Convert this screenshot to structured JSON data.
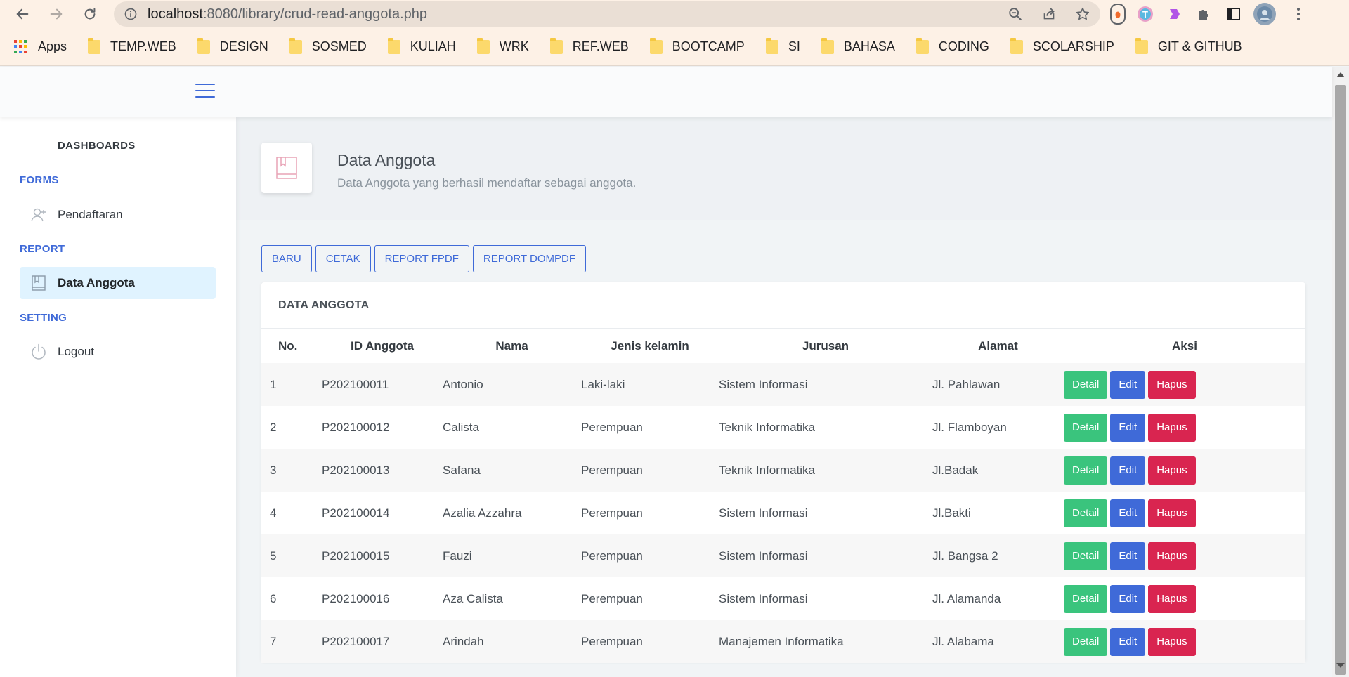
{
  "browser": {
    "url_host": "localhost",
    "url_rest": ":8080/library/crud-read-anggota.php",
    "apps_label": "Apps",
    "bookmarks": [
      "TEMP.WEB",
      "DESIGN",
      "SOSMED",
      "KULIAH",
      "WRK",
      "REF.WEB",
      "BOOTCAMP",
      "SI",
      "BAHASA",
      "CODING",
      "SCOLARSHIP",
      "GIT & GITHUB"
    ]
  },
  "sidebar": {
    "dashboards": "DASHBOARDS",
    "forms_heading": "FORMS",
    "pendaftaran": "Pendaftaran",
    "report_heading": "REPORT",
    "data_anggota": "Data Anggota",
    "setting_heading": "SETTING",
    "logout": "Logout"
  },
  "page": {
    "title": "Data Anggota",
    "subtitle": "Data Anggota yang berhasil mendaftar sebagai anggota."
  },
  "toolbar": {
    "baru": "BARU",
    "cetak": "CETAK",
    "fpdf": "REPORT FPDF",
    "dompdf": "REPORT DOMPDF"
  },
  "table": {
    "card_title": "DATA ANGGOTA",
    "headers": [
      "No.",
      "ID Anggota",
      "Nama",
      "Jenis kelamin",
      "Jurusan",
      "Alamat",
      "Aksi"
    ],
    "actions": {
      "detail": "Detail",
      "edit": "Edit",
      "hapus": "Hapus"
    },
    "rows": [
      [
        "1",
        "P202100011",
        "Antonio",
        "Laki-laki",
        "Sistem Informasi",
        "Jl. Pahlawan"
      ],
      [
        "2",
        "P202100012",
        "Calista",
        "Perempuan",
        "Teknik Informatika",
        "Jl. Flamboyan"
      ],
      [
        "3",
        "P202100013",
        "Safana",
        "Perempuan",
        "Teknik Informatika",
        "Jl.Badak"
      ],
      [
        "4",
        "P202100014",
        "Azalia Azzahra",
        "Perempuan",
        "Sistem Informasi",
        "Jl.Bakti"
      ],
      [
        "5",
        "P202100015",
        "Fauzi",
        "Perempuan",
        "Sistem Informasi",
        "Jl. Bangsa 2"
      ],
      [
        "6",
        "P202100016",
        "Aza Calista",
        "Perempuan",
        "Sistem Informasi",
        "Jl. Alamanda"
      ],
      [
        "7",
        "P202100017",
        "Arindah",
        "Perempuan",
        "Manajemen Informatika",
        "Jl. Alabama"
      ]
    ]
  },
  "colors": {
    "primary": "#3f6ad8",
    "success": "#3ac47d",
    "danger": "#d92550",
    "active_bg": "#e0f3ff"
  },
  "icons": {
    "back": "arrow-left-icon",
    "forward": "arrow-right-icon",
    "reload": "reload-icon",
    "info": "info-icon",
    "zoom": "zoom-out-icon",
    "share": "share-icon",
    "star": "star-icon",
    "extensions": "puzzle-icon",
    "side_panel": "side-panel-icon",
    "menu": "kebab-menu-icon",
    "hamburger": "hamburger-icon",
    "user_add": "user-add-icon",
    "book": "book-icon",
    "power": "power-icon"
  }
}
